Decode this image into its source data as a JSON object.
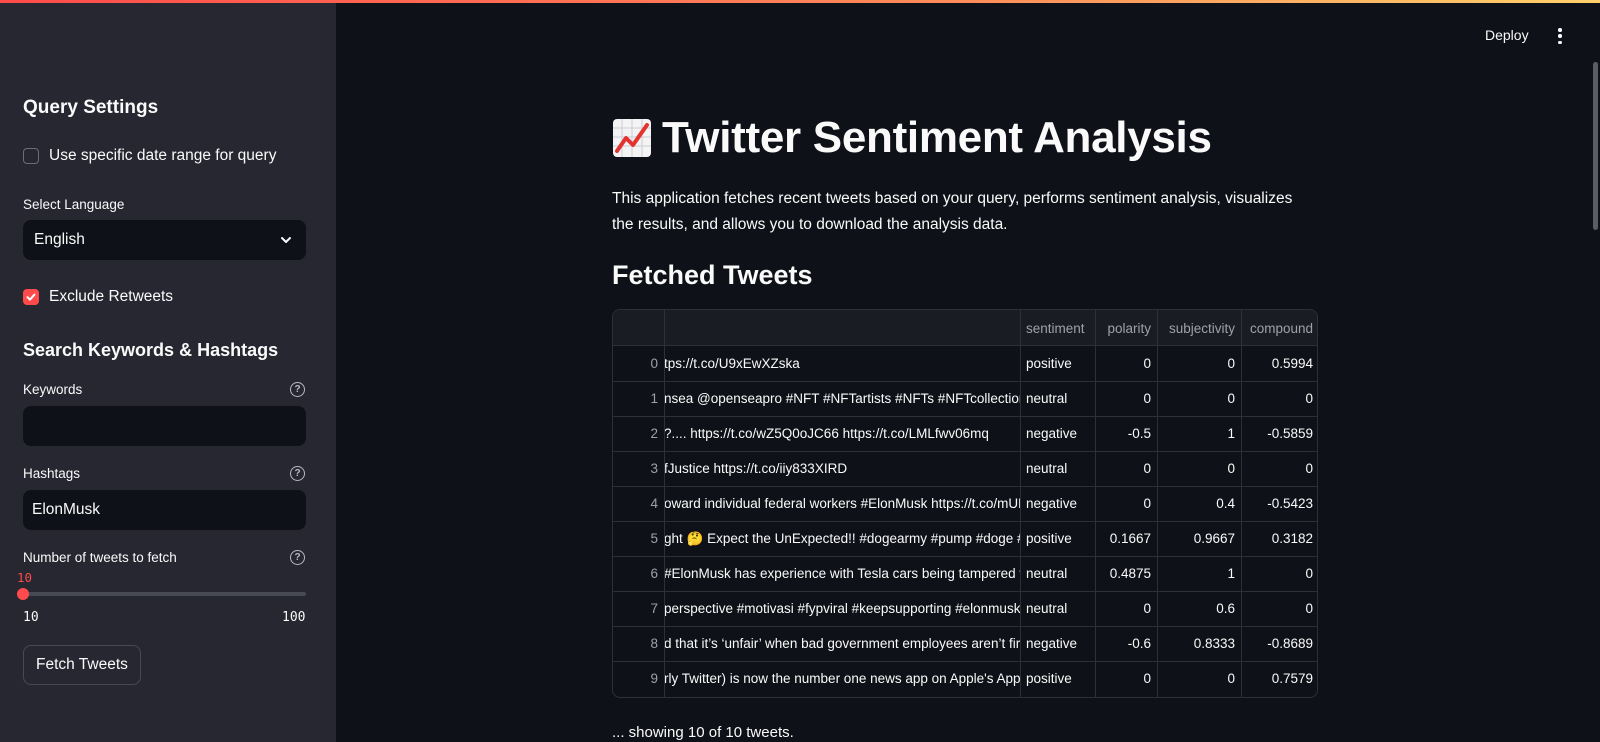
{
  "sidebar": {
    "query_settings_title": "Query Settings",
    "date_range_checkbox": "Use specific date range for query",
    "language_label": "Select Language",
    "language_value": "English",
    "exclude_retweets_label": "Exclude Retweets",
    "keywords_section_title": "Search Keywords & Hashtags",
    "keywords_label": "Keywords",
    "keywords_value": "",
    "hashtags_label": "Hashtags",
    "hashtags_value": "ElonMusk",
    "tweet_count_label": "Number of tweets to fetch",
    "tweet_count_value": "10",
    "tweet_count_min": "10",
    "tweet_count_max": "100",
    "fetch_button": "Fetch Tweets",
    "help_glyph": "?"
  },
  "header": {
    "deploy_label": "Deploy"
  },
  "main": {
    "title_icon": "chart-increasing-icon",
    "title": "Twitter Sentiment Analysis",
    "description": "This application fetches recent tweets based on your query, performs sentiment analysis, visualizes the results, and allows you to download the analysis data.",
    "section_title": "Fetched Tweets",
    "columns": [
      "",
      "",
      "sentiment",
      "polarity",
      "subjectivity",
      "compound"
    ],
    "rows": [
      {
        "index": "0",
        "tweet": "tps://t.co/U9xEwXZska",
        "sentiment": "positive",
        "polarity": "0",
        "subjectivity": "0",
        "compound": "0.5994"
      },
      {
        "index": "1",
        "tweet": "nsea  @openseapro  #NFT #NFTartists #NFTs #NFTcollection #",
        "sentiment": "neutral",
        "polarity": "0",
        "subjectivity": "0",
        "compound": "0"
      },
      {
        "index": "2",
        "tweet": "?....  https://t.co/wZ5Q0oJC66 https://t.co/LMLfwv06mq",
        "sentiment": "negative",
        "polarity": "-0.5",
        "subjectivity": "1",
        "compound": "-0.5859"
      },
      {
        "index": "3",
        "tweet": "fJustice https://t.co/iiy833XIRD",
        "sentiment": "neutral",
        "polarity": "0",
        "subjectivity": "0",
        "compound": "0"
      },
      {
        "index": "4",
        "tweet": "oward individual federal workers #ElonMusk https://t.co/mUE",
        "sentiment": "negative",
        "polarity": "0",
        "subjectivity": "0.4",
        "compound": "-0.5423"
      },
      {
        "index": "5",
        "tweet": "ght 🤔   Expect the UnExpected!! #dogearmy #pump #doge #E",
        "sentiment": "positive",
        "polarity": "0.1667",
        "subjectivity": "0.9667",
        "compound": "0.3182"
      },
      {
        "index": "6",
        "tweet": "#ElonMusk has experience with Tesla cars being tampered wit",
        "sentiment": "neutral",
        "polarity": "0.4875",
        "subjectivity": "1",
        "compound": "0"
      },
      {
        "index": "7",
        "tweet": " perspective #motivasi #fypviral #keepsupporting #elonmusk",
        "sentiment": "neutral",
        "polarity": "0",
        "subjectivity": "0.6",
        "compound": "0"
      },
      {
        "index": "8",
        "tweet": "d that it’s ‘unfair’ when bad government employees aren’t fire",
        "sentiment": "negative",
        "polarity": "-0.6",
        "subjectivity": "0.8333",
        "compound": "-0.8689"
      },
      {
        "index": "9",
        "tweet": "rly Twitter) is now the number one news app on Apple's App S",
        "sentiment": "positive",
        "polarity": "0",
        "subjectivity": "0",
        "compound": "0.7579"
      }
    ],
    "footnote": "... showing 10 of 10 tweets."
  },
  "colors": {
    "accent": "#ff4b4b",
    "sidebar_bg": "#262730",
    "main_bg": "#0e1117"
  }
}
